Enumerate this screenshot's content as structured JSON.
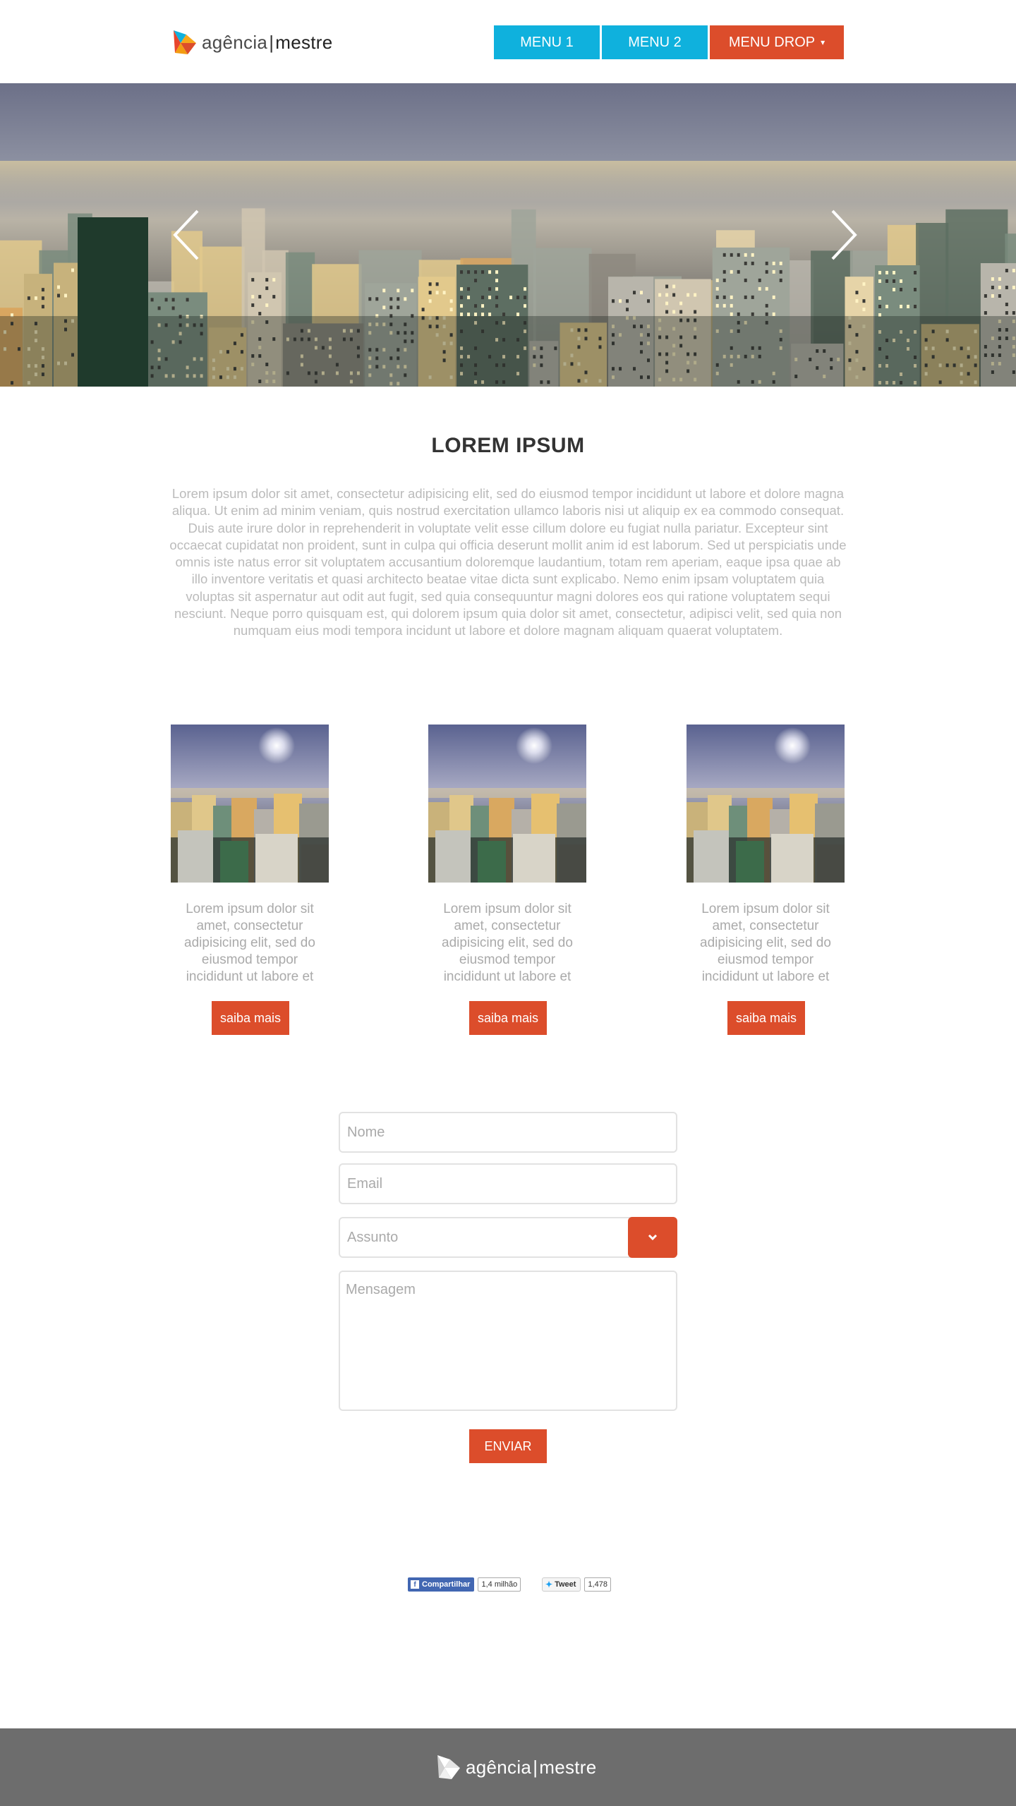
{
  "brand": {
    "name_light": "agência",
    "separator": "|",
    "name_bold": "mestre"
  },
  "nav": {
    "items": [
      {
        "label": "MENU 1"
      },
      {
        "label": "MENU 2"
      },
      {
        "label": "MENU DROP",
        "caret": "▾"
      }
    ]
  },
  "hero": {
    "prev_icon": "chevron-left-icon",
    "next_icon": "chevron-right-icon"
  },
  "intro": {
    "title": "LOREM IPSUM",
    "text": "Lorem ipsum dolor sit amet, consectetur adipisicing elit, sed do eiusmod tempor incididunt ut labore et dolore magna aliqua. Ut enim ad minim veniam, quis nostrud exercitation ullamco laboris nisi ut aliquip ex ea commodo consequat. Duis aute irure dolor in reprehenderit in voluptate velit esse cillum dolore eu fugiat nulla pariatur. Excepteur sint occaecat cupidatat non proident, sunt in culpa qui officia deserunt mollit anim id est laborum. Sed ut perspiciatis unde omnis iste natus error sit voluptatem accusantium doloremque laudantium, totam rem aperiam, eaque ipsa quae ab illo inventore veritatis et quasi architecto beatae vitae dicta sunt explicabo. Nemo enim ipsam voluptatem quia voluptas sit aspernatur aut odit aut fugit, sed quia consequuntur magni dolores eos qui ratione voluptatem sequi nesciunt. Neque porro quisquam est, qui dolorem ipsum quia dolor sit amet, consectetur, adipisci velit, sed quia non numquam eius modi tempora incidunt ut labore et dolore magnam aliquam quaerat voluptatem."
  },
  "cards": [
    {
      "text": "Lorem ipsum dolor sit amet, consectetur adipisicing elit, sed do eiusmod tempor incididunt ut labore et",
      "button": "saiba mais"
    },
    {
      "text": "Lorem ipsum dolor sit amet, consectetur adipisicing elit, sed do eiusmod tempor incididunt ut labore et",
      "button": "saiba mais"
    },
    {
      "text": "Lorem ipsum dolor sit amet, consectetur adipisicing elit, sed do eiusmod tempor incididunt ut labore et",
      "button": "saiba mais"
    }
  ],
  "form": {
    "name_placeholder": "Nome",
    "email_placeholder": "Email",
    "subject_placeholder": "Assunto",
    "message_placeholder": "Mensagem",
    "submit": "ENVIAR"
  },
  "social": {
    "facebook_label": "Compartilhar",
    "facebook_count": "1,4 milhão",
    "twitter_label": "Tweet",
    "twitter_count": "1,478"
  },
  "colors": {
    "blue": "#0fb1dd",
    "orange": "#dc4d2b",
    "footer": "#6d6d6d"
  }
}
